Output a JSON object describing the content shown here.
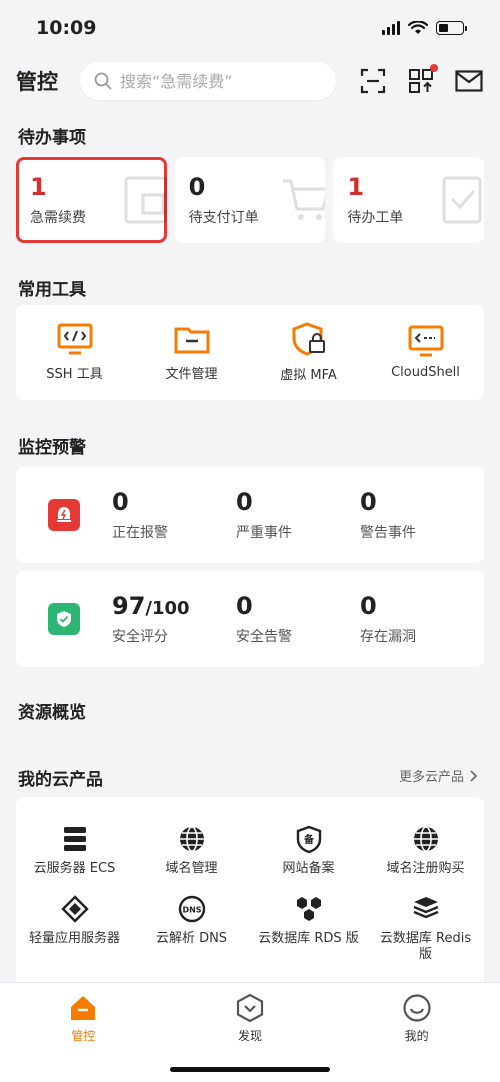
{
  "status": {
    "time": "10:09"
  },
  "header": {
    "title": "管控",
    "search_placeholder": "搜索“急需续费”"
  },
  "todo": {
    "title": "待办事项",
    "items": [
      {
        "value": "1",
        "label": "急需续费"
      },
      {
        "value": "0",
        "label": "待支付订单"
      },
      {
        "value": "1",
        "label": "待办工单"
      }
    ]
  },
  "tools": {
    "title": "常用工具",
    "items": [
      {
        "label": "SSH 工具",
        "icon": "terminal-icon"
      },
      {
        "label": "文件管理",
        "icon": "folder-icon"
      },
      {
        "label": "虚拟 MFA",
        "icon": "shield-lock-icon"
      },
      {
        "label": "CloudShell",
        "icon": "cloudshell-icon"
      }
    ]
  },
  "monitor": {
    "title": "监控预警",
    "alerts": [
      {
        "value": "0",
        "label": "正在报警"
      },
      {
        "value": "0",
        "label": "严重事件"
      },
      {
        "value": "0",
        "label": "警告事件"
      }
    ],
    "security": {
      "score": "97",
      "score_total": "/100",
      "score_label": "安全评分",
      "items": [
        {
          "value": "0",
          "label": "安全告警"
        },
        {
          "value": "0",
          "label": "存在漏洞"
        }
      ]
    }
  },
  "resources": {
    "title": "资源概览"
  },
  "products": {
    "title": "我的云产品",
    "more": "更多云产品",
    "items": [
      {
        "label": "云服务器 ECS",
        "icon": "server-icon"
      },
      {
        "label": "域名管理",
        "icon": "globe-icon"
      },
      {
        "label": "网站备案",
        "icon": "badge-icon"
      },
      {
        "label": "域名注册购买",
        "icon": "globe-icon"
      },
      {
        "label": "轻量应用服务器",
        "icon": "cube-icon"
      },
      {
        "label": "云解析 DNS",
        "icon": "dns-icon"
      },
      {
        "label": "云数据库 RDS 版",
        "icon": "hexagons-icon"
      },
      {
        "label": "云数据库 Redis 版",
        "icon": "layers-icon"
      }
    ]
  },
  "tabs": [
    {
      "label": "管控",
      "active": true
    },
    {
      "label": "发现",
      "active": false
    },
    {
      "label": "我的",
      "active": false
    }
  ],
  "colors": {
    "accent": "#f57c00",
    "red": "#d32f2f",
    "green": "#2bb673"
  }
}
